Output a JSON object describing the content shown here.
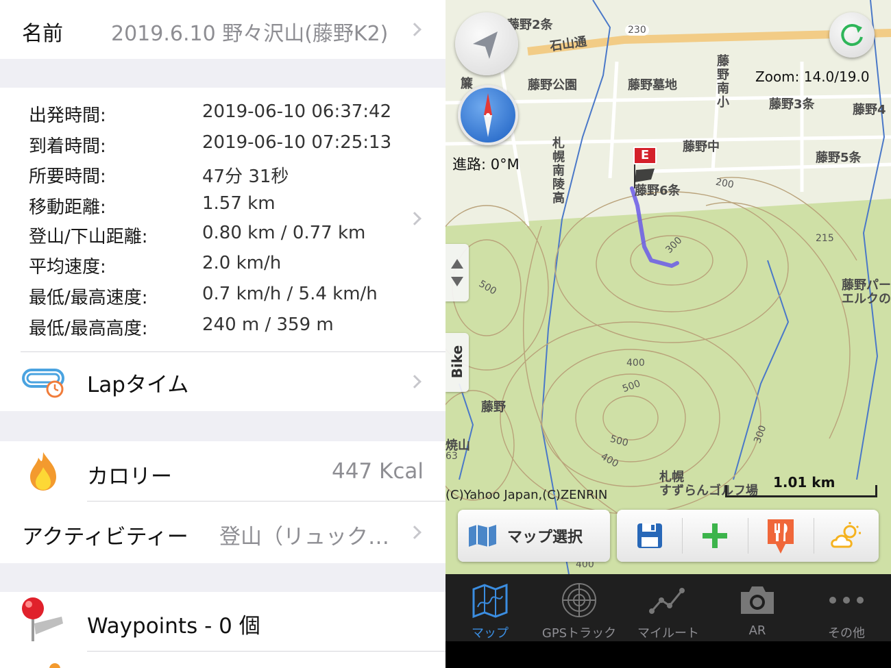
{
  "track": {
    "name_label": "名前",
    "name_value": "2019.6.10 野々沢山(藤野K2)"
  },
  "stats": [
    {
      "label": "出発時間:",
      "value": "2019-06-10 06:37:42"
    },
    {
      "label": "到着時間:",
      "value": "2019-06-10 07:25:13"
    },
    {
      "label": "所要時間:",
      "value": "47分 31秒"
    },
    {
      "label": "移動距離:",
      "value": "1.57 km"
    },
    {
      "label": "登山/下山距離:",
      "value": "0.80 km / 0.77 km"
    },
    {
      "label": "平均速度:",
      "value": "2.0 km/h"
    },
    {
      "label": "最低/最高速度:",
      "value": "0.7 km/h / 5.4 km/h"
    },
    {
      "label": "最低/最高高度:",
      "value": "240 m / 359 m"
    }
  ],
  "lap": {
    "label": "Lapタイム"
  },
  "calorie": {
    "label": "カロリー",
    "value": "447 Kcal"
  },
  "activity": {
    "label": "アクティビティー",
    "value": "登山（リュック…"
  },
  "waypoints": {
    "label": "Waypoints - 0 個"
  },
  "map": {
    "zoom": "Zoom: 14.0/19.0",
    "heading": "進路: 0°M",
    "bike_label": "Bike",
    "copyright": "(C)Yahoo Japan,(C)ZENRIN",
    "scale": "1.01 km",
    "map_select_label": "マップ選択",
    "end_marker": "E",
    "places": {
      "fujino2": "藤野2条",
      "ishiyama": "石山通",
      "road230": "230",
      "fujino_park": "藤野公園",
      "fujino_cemetery": "藤野墓地",
      "fujino_south": "藤野南小",
      "fujino3": "藤野3条",
      "fujino4": "藤野4",
      "fujino_jh": "藤野中",
      "fujino5": "藤野5条",
      "fujino6": "藤野6条",
      "sapporo_hs": "札幌南陵高",
      "fujino_park2": "藤野パー",
      "elk": "エルクの",
      "fujino": "藤野",
      "yakeyama": "焼山",
      "golf1": "札幌",
      "golf2": "すずらんゴルフ場",
      "sakura": "簾",
      "c200": "200",
      "c215": "215",
      "c300a": "300",
      "c300b": "300",
      "c400a": "400",
      "c400b": "400",
      "c400c": "400",
      "c500a": "500",
      "c500b": "500",
      "c500c": "500",
      "c63": "63"
    }
  },
  "tabs": [
    {
      "label": "マップ",
      "icon": "map-icon",
      "active": true
    },
    {
      "label": "GPSトラック",
      "icon": "radar-icon",
      "active": false
    },
    {
      "label": "マイルート",
      "icon": "route-icon",
      "active": false
    },
    {
      "label": "AR",
      "icon": "camera-icon",
      "active": false
    },
    {
      "label": "その他",
      "icon": "more-icon",
      "active": false
    }
  ],
  "colors": {
    "accent": "#3b8de0",
    "track": "#6a5ae8",
    "map_bg": "#d9e6b3",
    "flame": "#f5a623"
  }
}
